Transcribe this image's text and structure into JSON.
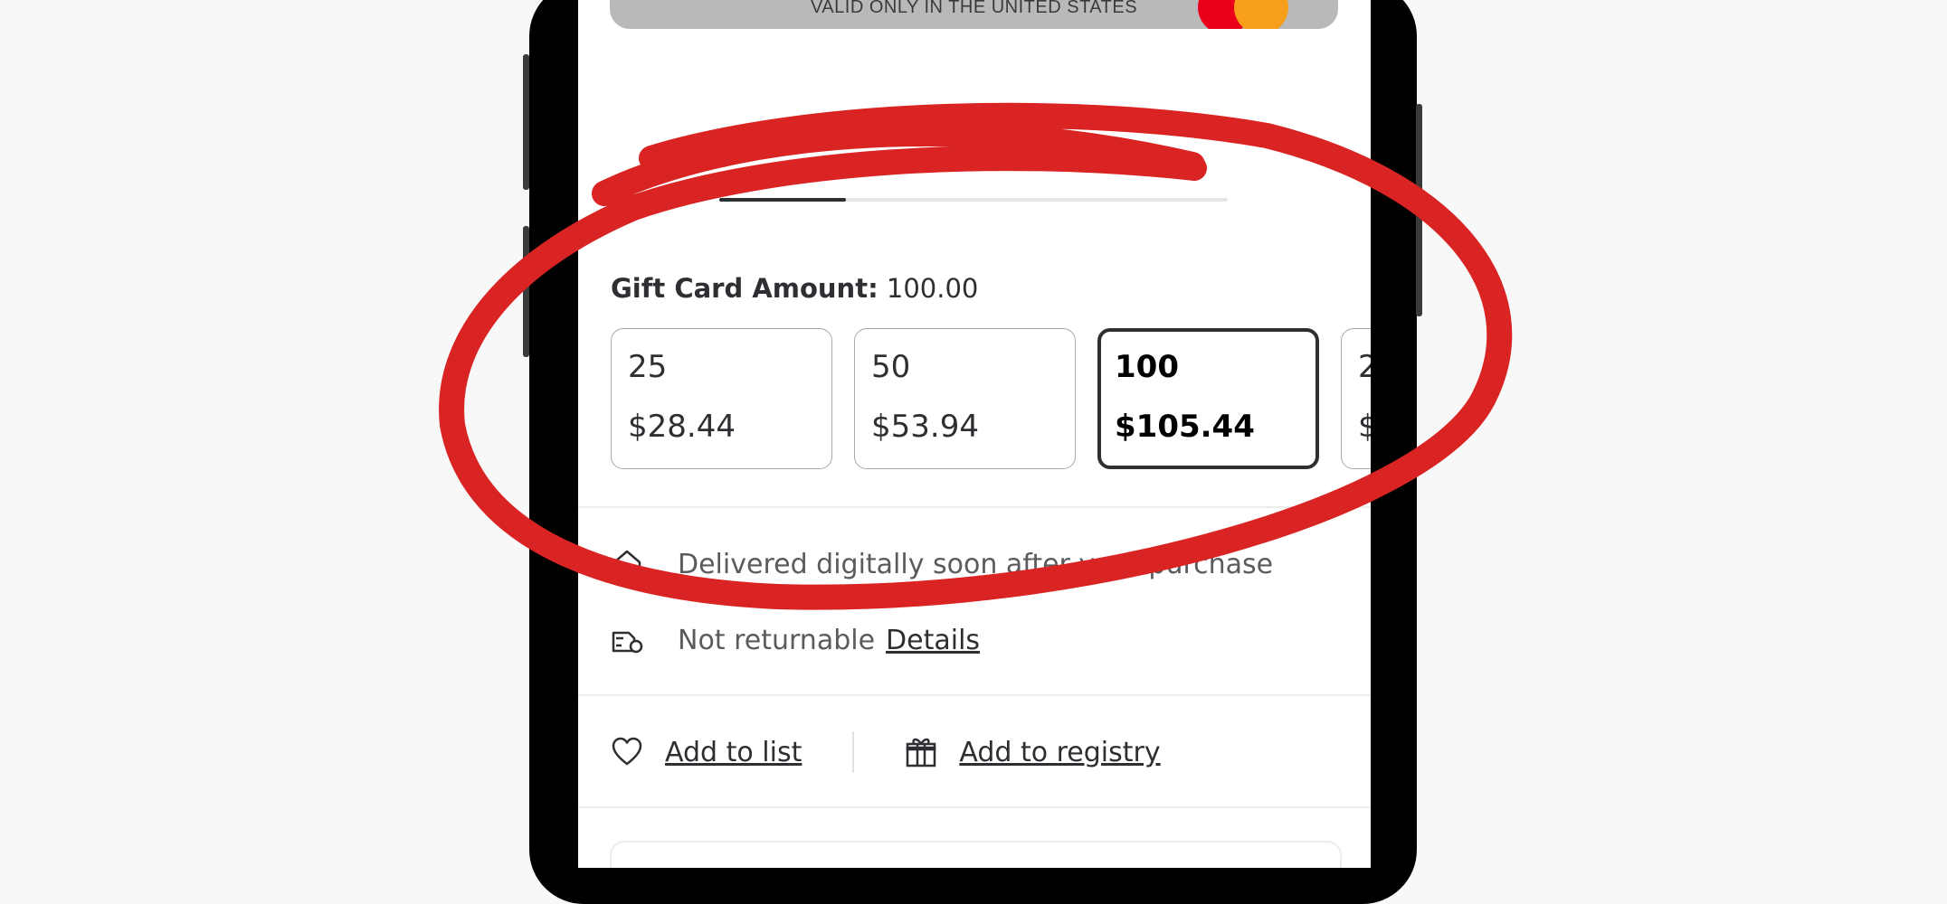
{
  "gift_card": {
    "legal_text": "VALID ONLY IN THE UNITED STATES"
  },
  "amount": {
    "label": "Gift Card Amount:",
    "selected_value": "100.00"
  },
  "options": [
    {
      "face": "25",
      "price": "$28.44",
      "selected": false
    },
    {
      "face": "50",
      "price": "$53.94",
      "selected": false
    },
    {
      "face": "100",
      "price": "$105.44",
      "selected": true
    },
    {
      "face": "2",
      "price": "$",
      "selected": false
    }
  ],
  "delivery": {
    "text": "Delivered digitally soon after your purchase"
  },
  "returns": {
    "text": "Not returnable",
    "link": "Details"
  },
  "actions": {
    "add_to_list": "Add to list",
    "add_to_registry": "Add to registry"
  },
  "colors": {
    "annotation_red": "#d92423",
    "text_dark": "#2e2f32",
    "card_gray": "#b9b9b9"
  },
  "icons": {
    "delivery": "home-icon",
    "returns": "return-icon",
    "list": "heart-icon",
    "registry": "gift-icon"
  }
}
